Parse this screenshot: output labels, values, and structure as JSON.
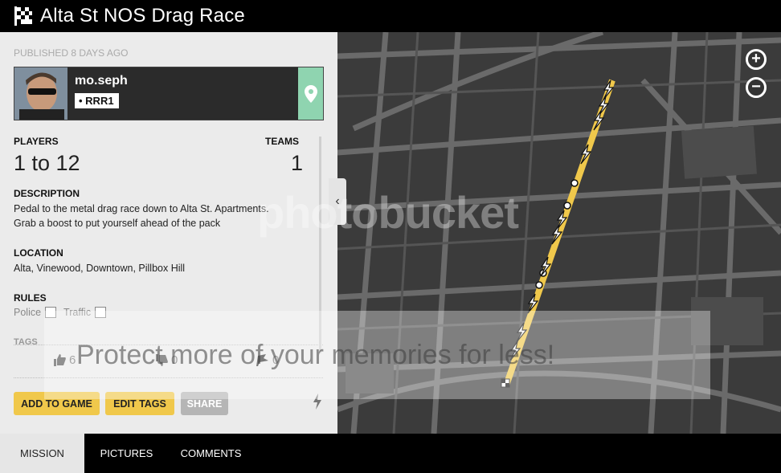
{
  "header": {
    "title": "Alta St NOS Drag Race",
    "logo_icon": "checkered-flag-icon"
  },
  "meta": {
    "published": "PUBLISHED 8 DAYS AGO"
  },
  "creator": {
    "name": "mo.seph",
    "crew": "RRR1",
    "location_icon": "map-pin-icon"
  },
  "stats": {
    "players_label": "PLAYERS",
    "players_value": "1 to 12",
    "teams_label": "TEAMS",
    "teams_value": "1"
  },
  "description": {
    "label": "DESCRIPTION",
    "line1": "Pedal to the metal drag race down to Alta St. Apartments.",
    "line2": "Grab a boost to put yourself ahead of the pack"
  },
  "location": {
    "label": "LOCATION",
    "value": "Alta, Vinewood, Downtown, Pillbox Hill"
  },
  "rules": {
    "label": "RULES",
    "police_label": "Police",
    "traffic_label": "Traffic"
  },
  "tags": {
    "label": "TAGS"
  },
  "votes": {
    "likes": "6",
    "dislikes": "0",
    "reports": "0"
  },
  "actions": {
    "add_to_game": "ADD TO GAME",
    "edit_tags": "EDIT TAGS",
    "share": "SHARE"
  },
  "map": {
    "zoom_in": "+",
    "zoom_out": "−",
    "route_color": "#f0c84b"
  },
  "watermark": {
    "brand": "photobucket",
    "slogan": "Protect more of your memories for less!"
  },
  "tabs": [
    {
      "label": "MISSION"
    },
    {
      "label": "PICTURES"
    },
    {
      "label": "COMMENTS"
    }
  ],
  "colors": {
    "accent_yellow": "#f0c84b",
    "location_green": "#8fd4b0",
    "header_bg": "#000000"
  }
}
